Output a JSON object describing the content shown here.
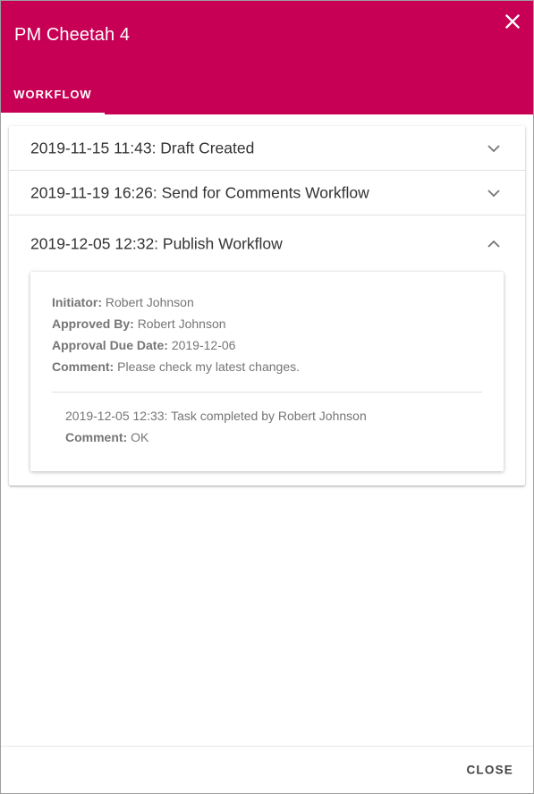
{
  "dialog": {
    "title": "PM Cheetah 4",
    "close_icon": "close-icon",
    "tab": "WORKFLOW",
    "close_button": "CLOSE"
  },
  "colors": {
    "header": "#c70055",
    "text": "#333333",
    "muted": "#757575"
  },
  "workflow": {
    "items": [
      {
        "title": "2019-11-15 11:43: Draft Created",
        "icon": "chevron-down-icon"
      },
      {
        "title": "2019-11-19 16:26: Send for Comments Workflow",
        "icon": "chevron-down-icon"
      },
      {
        "title": "2019-12-05 12:32: Publish Workflow",
        "icon": "chevron-up-icon"
      }
    ],
    "details": {
      "initiator_label": "Initiator:",
      "initiator": "Robert Johnson",
      "approved_by_label": "Approved By:",
      "approved_by": "Robert Johnson",
      "due_label": "Approval Due Date:",
      "due": "2019-12-06",
      "comment_label": "Comment:",
      "comment": "Please check my latest changes.",
      "task_text": "2019-12-05 12:33: Task completed by Robert Johnson",
      "task_comment_label": "Comment:",
      "task_comment": "OK"
    }
  }
}
